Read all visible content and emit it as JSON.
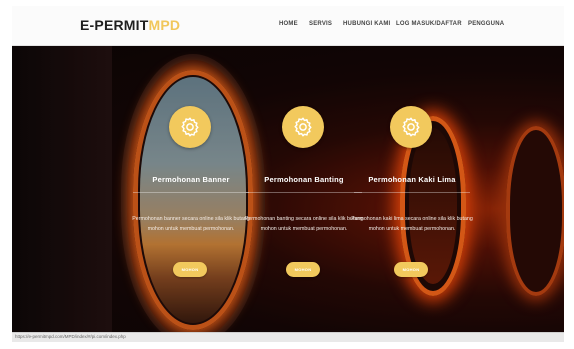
{
  "brand": {
    "part1": "E-PERMIT",
    "part2": "MPD"
  },
  "nav": {
    "home": "HOME",
    "servis": "SERVIS",
    "hubungi": "HUBUNGI KAMI",
    "log": "LOG MASUK/DAFTAR",
    "pengguna": "PENGGUNA"
  },
  "cards": [
    {
      "icon": "gear-icon",
      "title": "Permohonan Banner",
      "desc": "Permohonan banner secara online sila klik butang mohon untuk membuat permohonan.",
      "button": "MOHON"
    },
    {
      "icon": "gear-icon",
      "title": "Permohonan Banting",
      "desc": "Permohonan banting secara online sila klik butang mohon untuk membuat permohonan.",
      "button": "MOHON"
    },
    {
      "icon": "gear-icon",
      "title": "Permohonan Kaki Lima",
      "desc": "Permohonan kaki lima secara online sila klik butang mohon untuk membuat permohonan.",
      "button": "MOHON"
    }
  ],
  "status_url": "https://e-permitmpd.com/MPD/index/#/pi.com/index.php",
  "colors": {
    "accent": "#f2c95d",
    "navbar_bg": "#fbfbfb",
    "brand_dark": "#1f1f1f"
  }
}
